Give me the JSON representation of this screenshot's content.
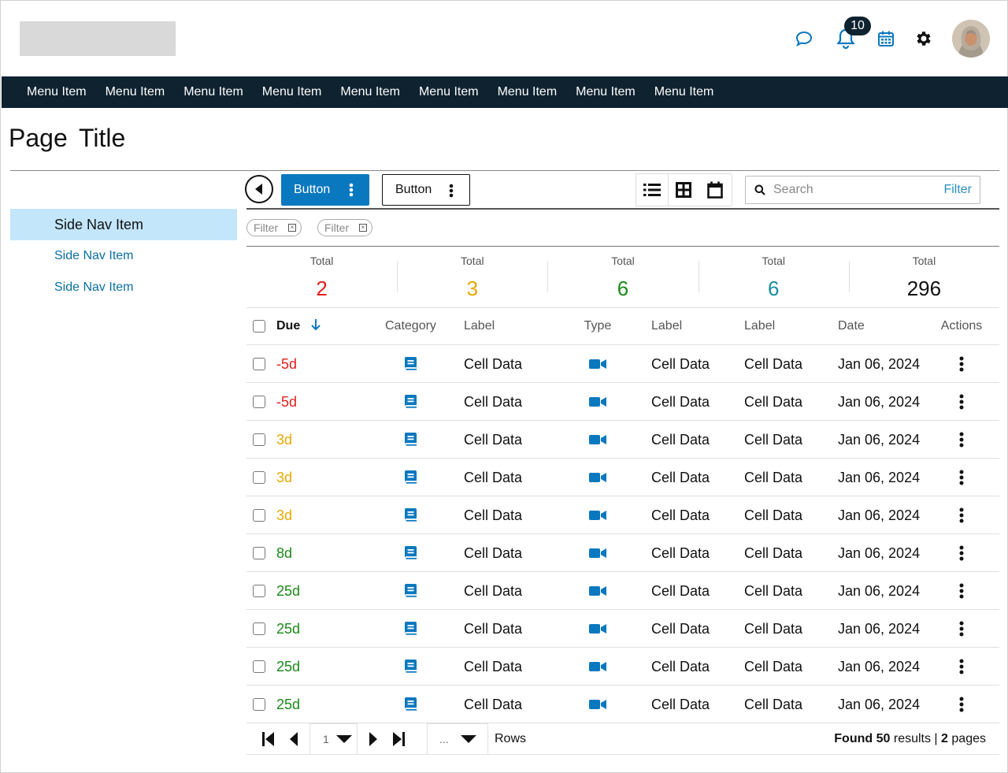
{
  "header": {
    "notification_count": "10",
    "icons": [
      "chat-icon",
      "bell-icon",
      "calendar-icon",
      "gear-icon"
    ]
  },
  "topnav": {
    "items": [
      "Menu Item",
      "Menu Item",
      "Menu Item",
      "Menu Item",
      "Menu Item",
      "Menu Item",
      "Menu Item",
      "Menu Item",
      "Menu Item"
    ]
  },
  "page": {
    "title": "Page Title"
  },
  "sidenav": {
    "items": [
      {
        "label": "Side Nav Item",
        "active": true
      },
      {
        "label": "Side Nav Item",
        "active": false
      },
      {
        "label": "Side Nav Item",
        "active": false
      }
    ]
  },
  "toolbar": {
    "primary_button": "Button",
    "secondary_button": "Button",
    "view_modes": [
      "list-view-icon",
      "grid-view-icon",
      "calendar-view-icon"
    ],
    "active_view": "list",
    "search_placeholder": "Search",
    "filter_link": "Filter"
  },
  "filters": [
    "Filter",
    "Filter"
  ],
  "summary": [
    {
      "label": "Total",
      "value": "2",
      "color": "#e0201c"
    },
    {
      "label": "Total",
      "value": "3",
      "color": "#e8a800"
    },
    {
      "label": "Total",
      "value": "6",
      "color": "#1a8a1a"
    },
    {
      "label": "Total",
      "value": "6",
      "color": "#1b8ea0"
    },
    {
      "label": "Total",
      "value": "296",
      "color": "#111111"
    }
  ],
  "table": {
    "headers": {
      "due": "Due",
      "category": "Category",
      "label1": "Label",
      "type": "Type",
      "label2": "Label",
      "label3": "Label",
      "date": "Date",
      "actions": "Actions"
    },
    "sort": {
      "column": "Due",
      "direction": "descending-arrow"
    },
    "rows": [
      {
        "due": "-5d",
        "due_color": "#e0201c",
        "label1": "Cell Data",
        "label2": "Cell Data",
        "label3": "Cell Data",
        "date": "Jan 06, 2024"
      },
      {
        "due": "-5d",
        "due_color": "#e0201c",
        "label1": "Cell Data",
        "label2": "Cell Data",
        "label3": "Cell Data",
        "date": "Jan 06, 2024"
      },
      {
        "due": "3d",
        "due_color": "#e8a800",
        "label1": "Cell Data",
        "label2": "Cell Data",
        "label3": "Cell Data",
        "date": "Jan 06, 2024"
      },
      {
        "due": "3d",
        "due_color": "#e8a800",
        "label1": "Cell Data",
        "label2": "Cell Data",
        "label3": "Cell Data",
        "date": "Jan 06, 2024"
      },
      {
        "due": "3d",
        "due_color": "#e8a800",
        "label1": "Cell Data",
        "label2": "Cell Data",
        "label3": "Cell Data",
        "date": "Jan 06, 2024"
      },
      {
        "due": "8d",
        "due_color": "#1a8a1a",
        "label1": "Cell Data",
        "label2": "Cell Data",
        "label3": "Cell Data",
        "date": "Jan 06, 2024"
      },
      {
        "due": "25d",
        "due_color": "#1a8a1a",
        "label1": "Cell Data",
        "label2": "Cell Data",
        "label3": "Cell Data",
        "date": "Jan 06, 2024"
      },
      {
        "due": "25d",
        "due_color": "#1a8a1a",
        "label1": "Cell Data",
        "label2": "Cell Data",
        "label3": "Cell Data",
        "date": "Jan 06, 2024"
      },
      {
        "due": "25d",
        "due_color": "#1a8a1a",
        "label1": "Cell Data",
        "label2": "Cell Data",
        "label3": "Cell Data",
        "date": "Jan 06, 2024"
      },
      {
        "due": "25d",
        "due_color": "#1a8a1a",
        "label1": "Cell Data",
        "label2": "Cell Data",
        "label3": "Cell Data",
        "date": "Jan 06, 2024"
      }
    ],
    "category_icon": "book-icon",
    "type_icon": "video-camera-icon",
    "action_icon": "kebab-menu-icon"
  },
  "pager": {
    "current_page": "1",
    "rows_value": "...",
    "rows_label": "Rows",
    "found_prefix": "Found",
    "found_count": "50",
    "found_mid": "results |",
    "page_count": "2",
    "found_suffix": "pages"
  },
  "colors": {
    "accent": "#0a78bf",
    "nav_bg": "#0f2230",
    "side_active_bg": "#c3e6fb",
    "link": "#0a6fa0"
  }
}
